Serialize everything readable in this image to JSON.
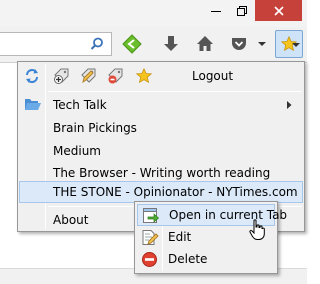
{
  "window": {
    "controls": [
      {
        "name": "minimize-icon"
      },
      {
        "name": "maximize-icon"
      },
      {
        "name": "close-icon"
      }
    ]
  },
  "toolbar": {
    "icons": [
      "search-icon",
      "green-arrow-icon",
      "download-icon",
      "home-icon",
      "pocket-icon",
      "dropdown-icon",
      "bookmark-star-icon"
    ]
  },
  "menu": {
    "logout_label": "Logout",
    "items": [
      {
        "label": "Tech Talk",
        "submenu": true
      },
      {
        "label": "Brain Pickings"
      },
      {
        "label": "Medium"
      },
      {
        "label": "The Browser - Writing worth reading"
      },
      {
        "label": "THE STONE - Opinionator - NYTimes.com"
      },
      {
        "label": "About"
      }
    ]
  },
  "submenu": {
    "items": [
      {
        "label": "Open in current Tab"
      },
      {
        "label": "Edit"
      },
      {
        "label": "Delete"
      }
    ]
  }
}
